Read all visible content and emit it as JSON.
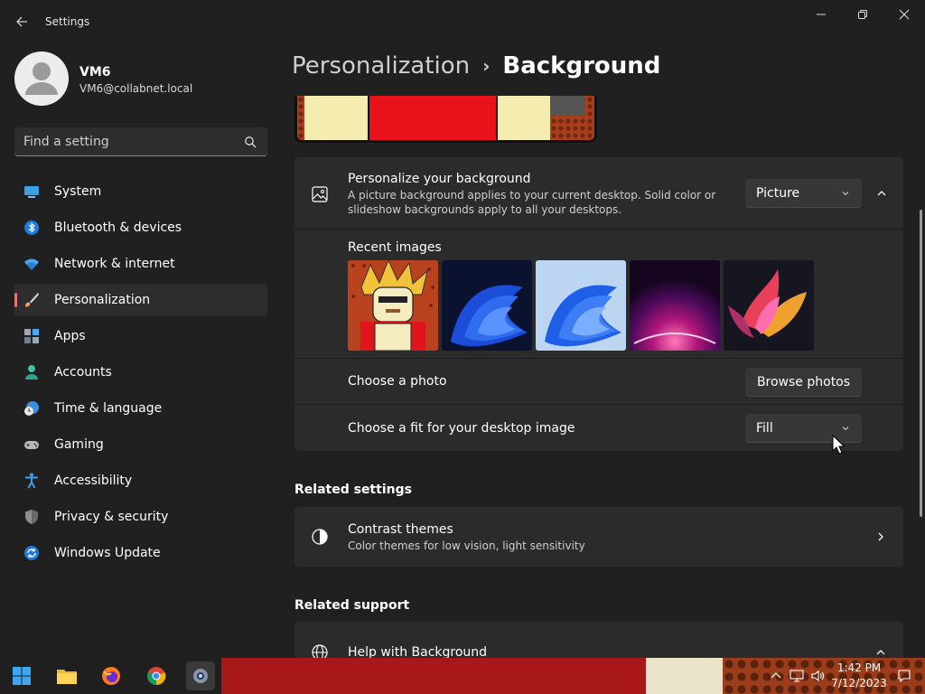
{
  "window": {
    "title": "Settings"
  },
  "profile": {
    "name": "VM6",
    "email": "VM6@collabnet.local"
  },
  "search": {
    "placeholder": "Find a setting"
  },
  "sidebar": {
    "items": [
      {
        "label": "System",
        "icon": "system-icon",
        "active": false
      },
      {
        "label": "Bluetooth & devices",
        "icon": "bluetooth-icon",
        "active": false
      },
      {
        "label": "Network & internet",
        "icon": "wifi-icon",
        "active": false
      },
      {
        "label": "Personalization",
        "icon": "brush-icon",
        "active": true
      },
      {
        "label": "Apps",
        "icon": "apps-icon",
        "active": false
      },
      {
        "label": "Accounts",
        "icon": "person-icon",
        "active": false
      },
      {
        "label": "Time & language",
        "icon": "clock-globe-icon",
        "active": false
      },
      {
        "label": "Gaming",
        "icon": "gamepad-icon",
        "active": false
      },
      {
        "label": "Accessibility",
        "icon": "accessibility-icon",
        "active": false
      },
      {
        "label": "Privacy & security",
        "icon": "shield-icon",
        "active": false
      },
      {
        "label": "Windows Update",
        "icon": "update-icon",
        "active": false
      }
    ]
  },
  "breadcrumb": {
    "parent": "Personalization",
    "separator": "›",
    "current": "Background"
  },
  "background": {
    "title": "Personalize your background",
    "description": "A picture background applies to your current desktop. Solid color or slideshow backgrounds apply to all your desktops.",
    "type_value": "Picture",
    "recent_images_label": "Recent images",
    "recent_images": [
      "comic-character",
      "blue-bloom-dark",
      "blue-bloom-light",
      "purple-glow",
      "colorful-flower"
    ],
    "choose_photo_label": "Choose a photo",
    "browse_label": "Browse photos",
    "fit_label": "Choose a fit for your desktop image",
    "fit_value": "Fill"
  },
  "related_settings": {
    "heading": "Related settings",
    "contrast_title": "Contrast themes",
    "contrast_desc": "Color themes for low vision, light sensitivity"
  },
  "related_support": {
    "heading": "Related support",
    "help_title": "Help with Background"
  },
  "taskbar": {
    "time": "1:42 PM",
    "date": "7/12/2023",
    "apps": [
      "start-icon",
      "file-explorer-icon",
      "firefox-icon",
      "chrome-icon",
      "settings-app-icon"
    ]
  },
  "colors": {
    "accent": "#e87575",
    "window_bg": "#202020",
    "card_bg": "#2b2b2b"
  }
}
